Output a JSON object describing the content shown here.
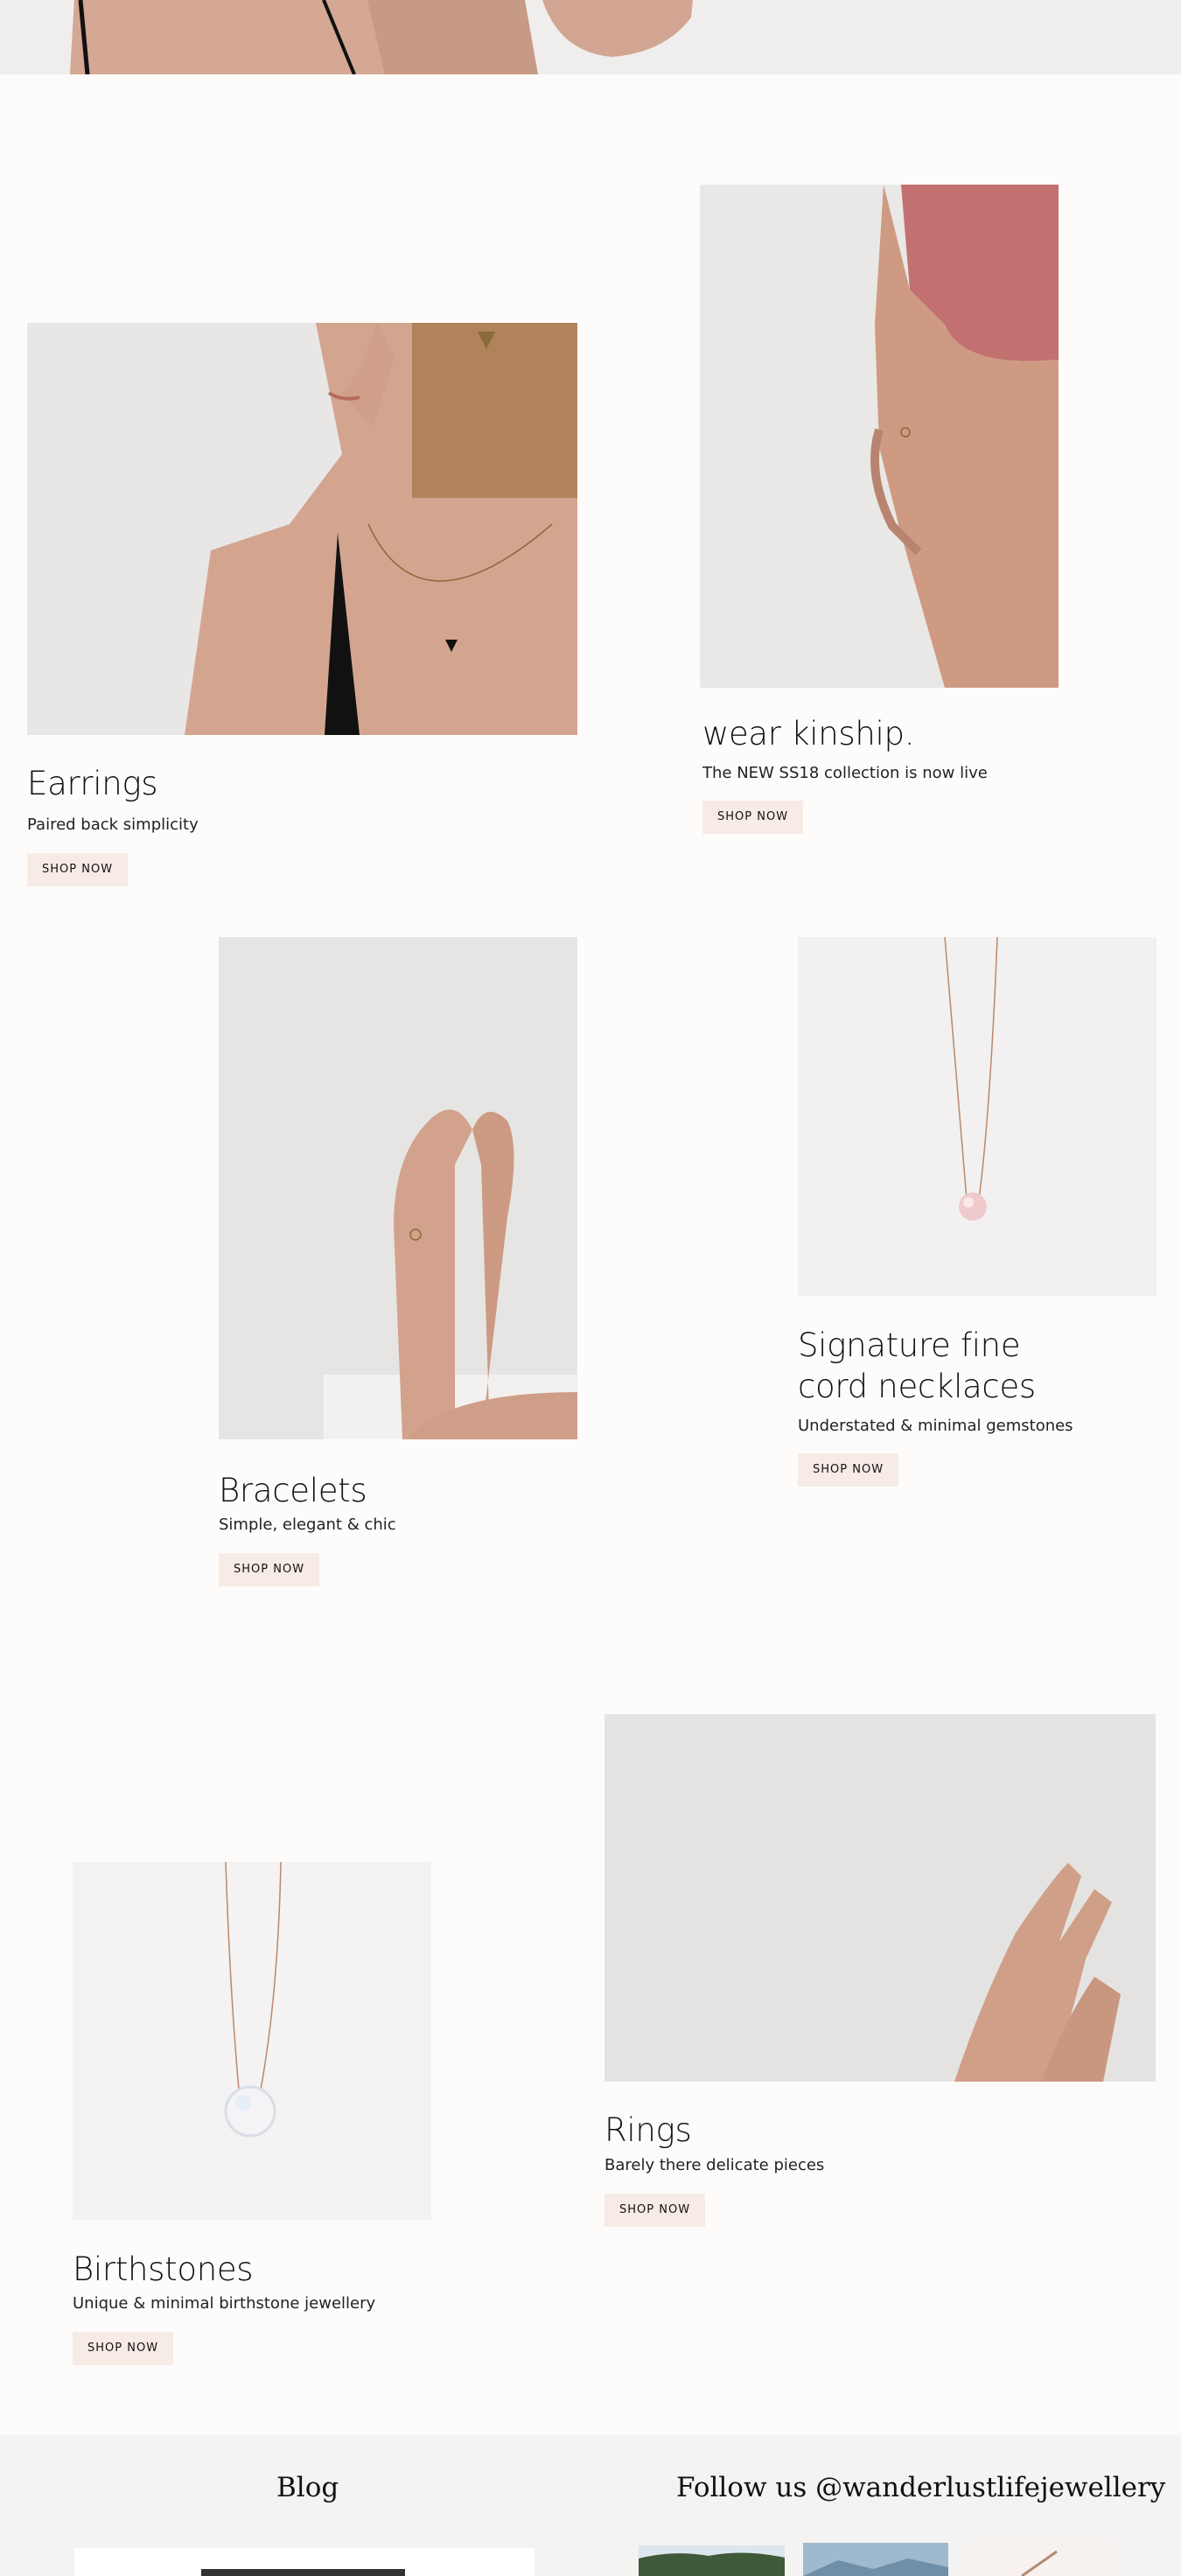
{
  "hero": {
    "alt": "Model with black strap top (cropped)"
  },
  "features": {
    "earrings": {
      "title": "Earrings",
      "subtitle": "Paired back simplicity",
      "cta": "SHOP NOW"
    },
    "kinship": {
      "title": "wear kinship.",
      "subtitle": "The NEW SS18 collection is now live",
      "cta": "SHOP NOW"
    },
    "bracelets": {
      "title": "Bracelets",
      "subtitle": "Simple, elegant & chic",
      "cta": "SHOP NOW"
    },
    "signature": {
      "title_line1": "Signature fine",
      "title_line2": "cord necklaces",
      "subtitle": "Understated & minimal gemstones",
      "cta": "SHOP NOW"
    },
    "rings": {
      "title": "Rings",
      "subtitle": "Barely there delicate pieces",
      "cta": "SHOP NOW"
    },
    "birthstones": {
      "title": "Birthstones",
      "subtitle": "Unique & minimal birthstone jewellery",
      "cta": "SHOP NOW"
    }
  },
  "footer": {
    "blog_heading": "Blog",
    "instagram_heading": "Follow us @wanderlustlifejewellery"
  }
}
